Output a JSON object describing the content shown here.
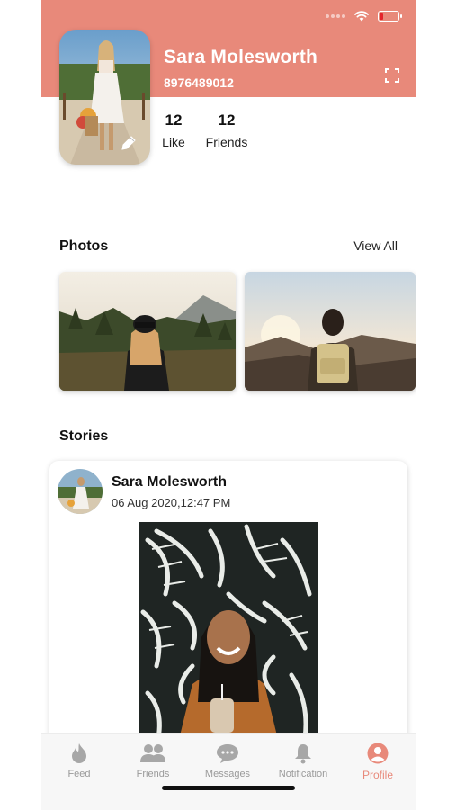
{
  "profile": {
    "name": "Sara Molesworth",
    "phone": "8976489012",
    "stats": [
      {
        "value": "12",
        "label": "Like"
      },
      {
        "value": "12",
        "label": "Friends"
      }
    ]
  },
  "photos": {
    "title": "Photos",
    "view_all_label": "View All"
  },
  "stories": {
    "title": "Stories",
    "items": [
      {
        "author": "Sara Molesworth",
        "timestamp": "06 Aug 2020,12:47 PM"
      }
    ]
  },
  "bottom_nav": {
    "items": [
      {
        "label": "Feed",
        "icon": "flame-icon",
        "active": false
      },
      {
        "label": "Friends",
        "icon": "people-icon",
        "active": false
      },
      {
        "label": "Messages",
        "icon": "chat-icon",
        "active": false
      },
      {
        "label": "Notification",
        "icon": "bell-icon",
        "active": false
      },
      {
        "label": "Profile",
        "icon": "profile-icon",
        "active": true
      }
    ]
  },
  "colors": {
    "accent": "#e8897a",
    "battery_low": "#e3242b",
    "nav_inactive": "#9a9a9a"
  }
}
